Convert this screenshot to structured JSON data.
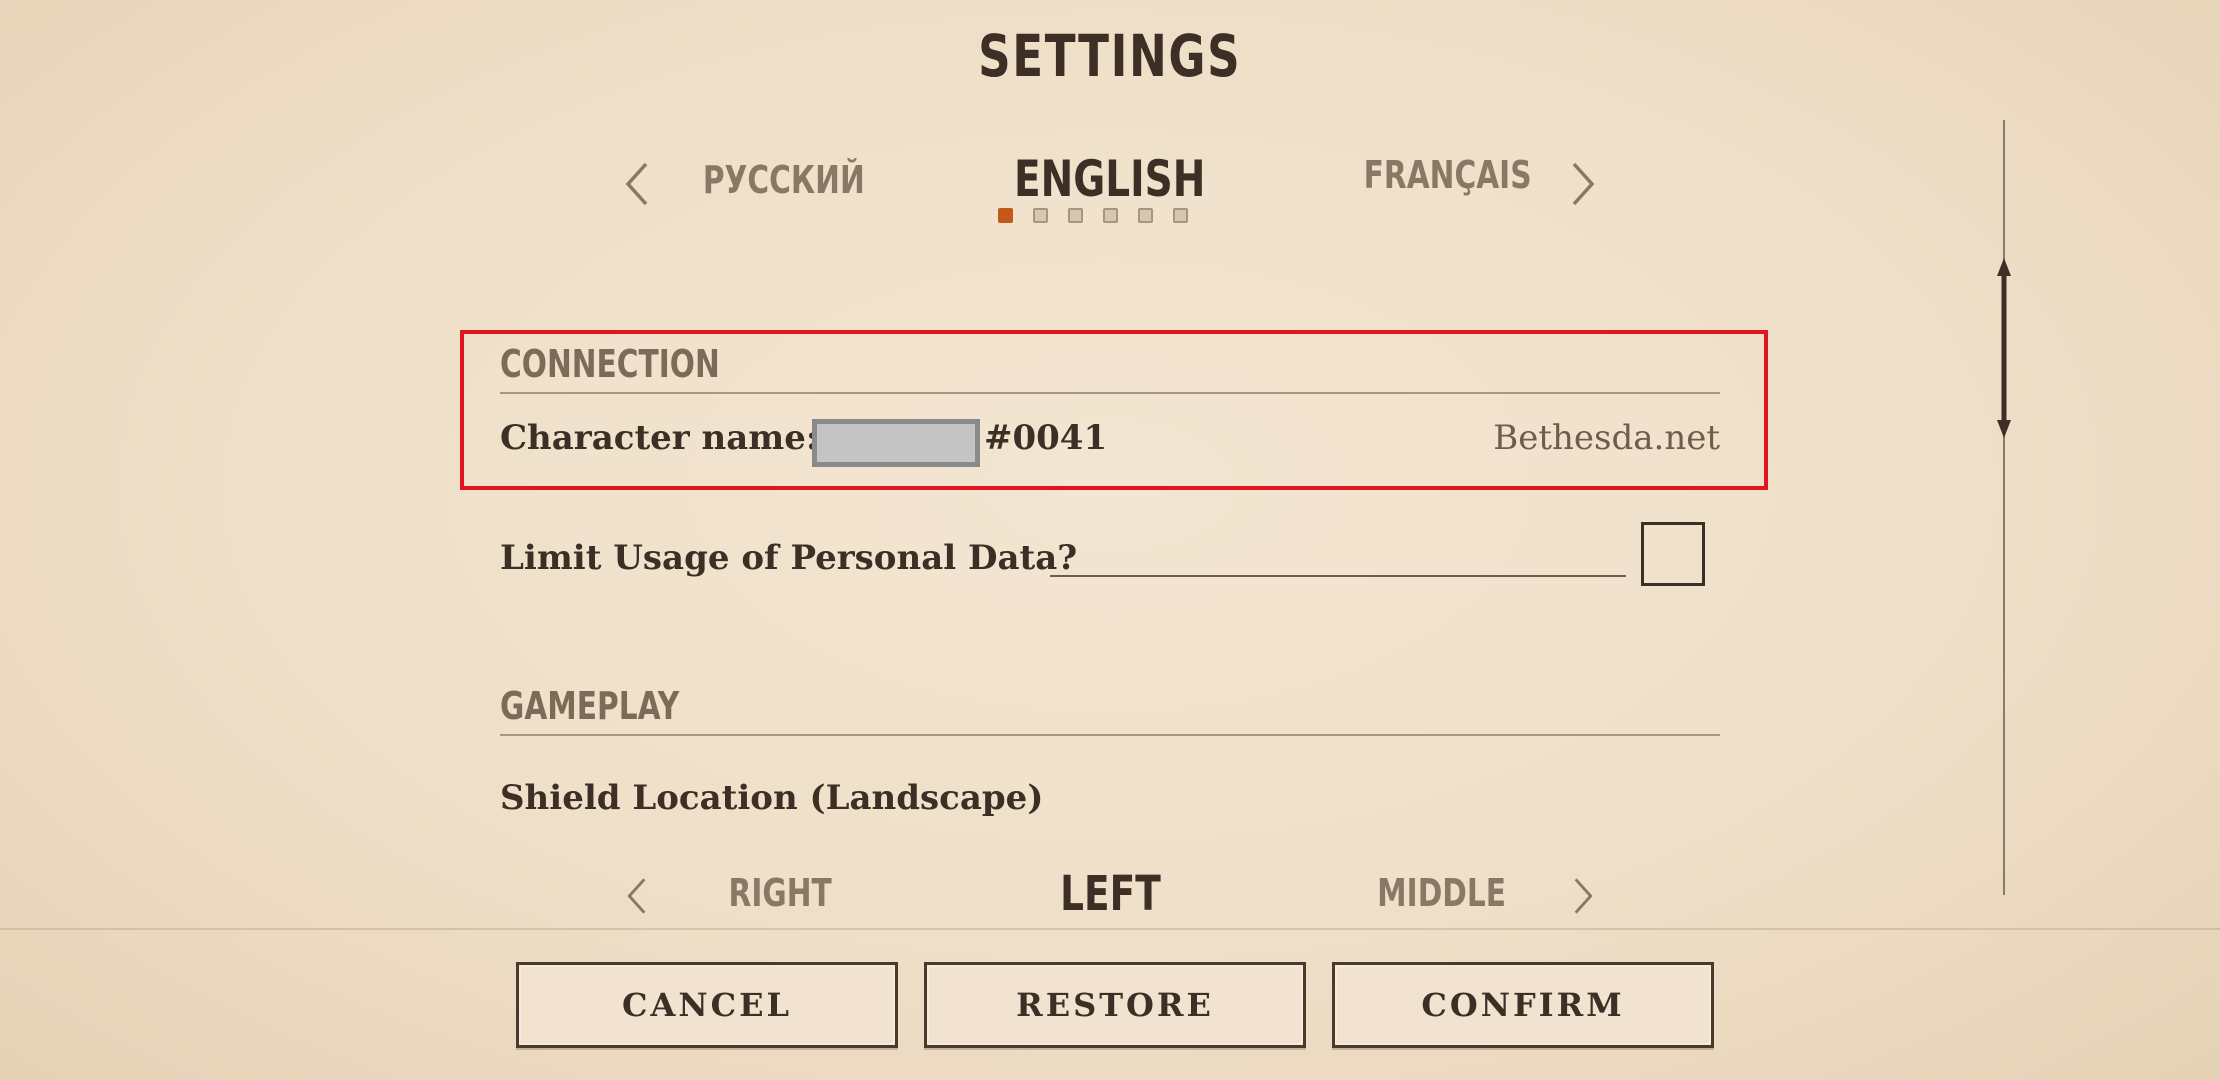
{
  "title": "SETTINGS",
  "language": {
    "prev": "РУССКИЙ",
    "selected": "ENGLISH",
    "next": "FRANÇAIS",
    "page_dots": 6,
    "active_dot": 1
  },
  "connection": {
    "heading": "CONNECTION",
    "character_label": "Character name:",
    "character_tag": "#0041",
    "account": "Bethesda.net"
  },
  "privacy": {
    "label": "Limit Usage of Personal Data?",
    "checked": false
  },
  "gameplay": {
    "heading": "GAMEPLAY",
    "shield_label": "Shield Location (Landscape)",
    "shield_prev": "RIGHT",
    "shield_selected": "LEFT",
    "shield_next": "MIDDLE"
  },
  "buttons": {
    "cancel": "CANCEL",
    "restore": "RESTORE",
    "confirm": "CONFIRM"
  },
  "colors": {
    "highlight": "#e0151f",
    "active_dot": "#c2581a",
    "text": "#3d2f26"
  }
}
